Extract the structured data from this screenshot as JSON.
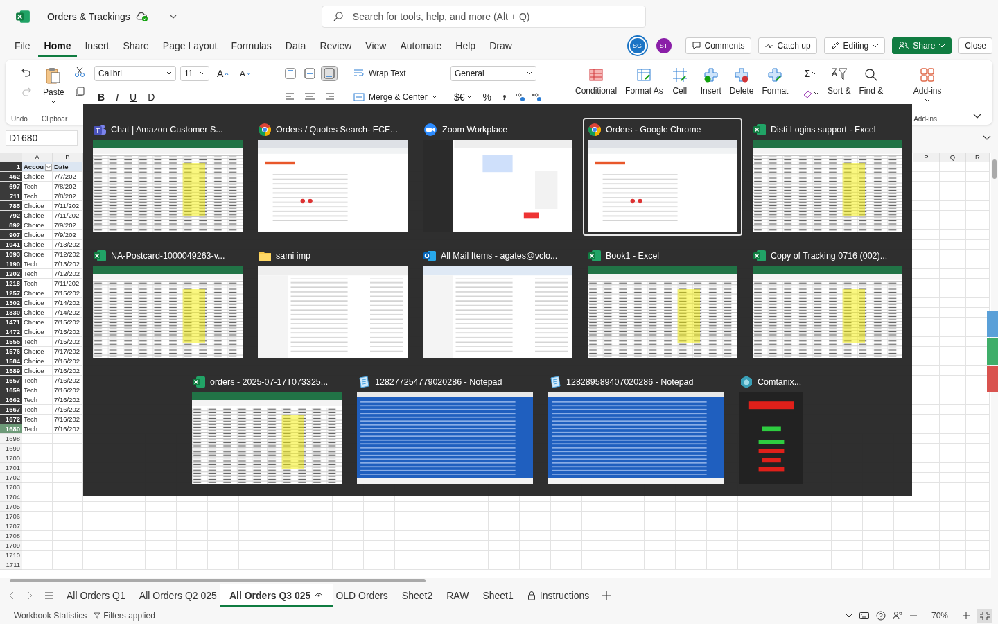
{
  "app": {
    "title": "Orders & Trackings",
    "search_placeholder": "Search for tools, help, and more (Alt + Q)"
  },
  "menu_tabs": [
    {
      "label": "File",
      "selected": false
    },
    {
      "label": "Home",
      "selected": true
    },
    {
      "label": "Insert",
      "selected": false
    },
    {
      "label": "Share",
      "selected": false
    },
    {
      "label": "Page Layout",
      "selected": false
    },
    {
      "label": "Formulas",
      "selected": false
    },
    {
      "label": "Data",
      "selected": false
    },
    {
      "label": "Review",
      "selected": false
    },
    {
      "label": "View",
      "selected": false
    },
    {
      "label": "Automate",
      "selected": false
    },
    {
      "label": "Help",
      "selected": false
    },
    {
      "label": "Draw",
      "selected": false
    }
  ],
  "avatars": [
    {
      "initials": "SG",
      "color": "#1b74c5",
      "active": true
    },
    {
      "initials": "ST",
      "color": "#8a1fa8",
      "active": false
    }
  ],
  "header_buttons": [
    {
      "label": "Comments",
      "kind": "comments"
    },
    {
      "label": "Catch up",
      "kind": "catchup"
    },
    {
      "label": "Editing",
      "kind": "editing"
    },
    {
      "label": "Share",
      "kind": "share"
    },
    {
      "label": "Close",
      "kind": "plain"
    }
  ],
  "ribbon": {
    "history": [
      {
        "kind": "undo",
        "disabled": false
      },
      {
        "kind": "redo",
        "disabled": true
      }
    ],
    "undo_label": "Undo",
    "paste": "Paste",
    "clipboard_label": "Clipboar",
    "font_name": "Calibri",
    "font_size": "11",
    "grow": "A",
    "shrink": "A",
    "styles": [
      "B",
      "I",
      "U",
      "D"
    ],
    "wrap": "Wrap Text",
    "merge": "Merge & Center",
    "number_format": "General",
    "currency": "$€",
    "percent": "%",
    "style_buttons": [
      "Conditional",
      "Format As",
      "Cell"
    ],
    "cell_buttons": [
      "Insert",
      "Delete",
      "Format"
    ],
    "sum": "Σ",
    "sort": "Sort &",
    "find": "Find &",
    "addins": "Add-ins",
    "addins_label": "Add-ins"
  },
  "name_box": "D1680",
  "grid": {
    "left_columns": [
      "A",
      "B"
    ],
    "right_columns": [
      "P",
      "Q",
      "R"
    ],
    "header_row": {
      "number": "1",
      "cells": [
        "Accou",
        "Date"
      ]
    },
    "rows": [
      {
        "number": "462",
        "cells": [
          "Choice",
          "7/7/202"
        ],
        "selected": false
      },
      {
        "number": "697",
        "cells": [
          "Tech",
          "7/8/202"
        ],
        "selected": false
      },
      {
        "number": "711",
        "cells": [
          "Tech",
          "7/8/202"
        ],
        "selected": false
      },
      {
        "number": "785",
        "cells": [
          "Choice",
          "7/11/202"
        ],
        "selected": false
      },
      {
        "number": "792",
        "cells": [
          "Choice",
          "7/11/202"
        ],
        "selected": false
      },
      {
        "number": "892",
        "cells": [
          "Choice",
          "7/9/202"
        ],
        "selected": false
      },
      {
        "number": "907",
        "cells": [
          "Choice",
          "7/9/202"
        ],
        "selected": false
      },
      {
        "number": "1041",
        "cells": [
          "Choice",
          "7/13/202"
        ],
        "selected": false
      },
      {
        "number": "1093",
        "cells": [
          "Choice",
          "7/12/202"
        ],
        "selected": false
      },
      {
        "number": "1190",
        "cells": [
          "Tech",
          "7/13/202"
        ],
        "selected": false
      },
      {
        "number": "1202",
        "cells": [
          "Tech",
          "7/12/202"
        ],
        "selected": false
      },
      {
        "number": "1218",
        "cells": [
          "Tech",
          "7/11/202"
        ],
        "selected": false
      },
      {
        "number": "1257",
        "cells": [
          "Choice",
          "7/15/202"
        ],
        "selected": false
      },
      {
        "number": "1302",
        "cells": [
          "Choice",
          "7/14/202"
        ],
        "selected": false
      },
      {
        "number": "1330",
        "cells": [
          "Choice",
          "7/14/202"
        ],
        "selected": false
      },
      {
        "number": "1471",
        "cells": [
          "Choice",
          "7/15/202"
        ],
        "selected": false
      },
      {
        "number": "1472",
        "cells": [
          "Choice",
          "7/15/202"
        ],
        "selected": false
      },
      {
        "number": "1555",
        "cells": [
          "Tech",
          "7/15/202"
        ],
        "selected": false
      },
      {
        "number": "1576",
        "cells": [
          "Choice",
          "7/17/202"
        ],
        "selected": false
      },
      {
        "number": "1584",
        "cells": [
          "Choice",
          "7/16/202"
        ],
        "selected": false
      },
      {
        "number": "1589",
        "cells": [
          "Choice",
          "7/16/202"
        ],
        "selected": false
      },
      {
        "number": "1657",
        "cells": [
          "Tech",
          "7/16/202"
        ],
        "selected": false
      },
      {
        "number": "1659",
        "cells": [
          "Tech",
          "7/16/202"
        ],
        "selected": false
      },
      {
        "number": "1662",
        "cells": [
          "Tech",
          "7/16/202"
        ],
        "selected": false
      },
      {
        "number": "1667",
        "cells": [
          "Tech",
          "7/16/202"
        ],
        "selected": false
      },
      {
        "number": "1672",
        "cells": [
          "Tech",
          "7/16/202"
        ],
        "selected": false
      },
      {
        "number": "1680",
        "cells": [
          "Tech",
          "7/16/202"
        ],
        "selected": true
      }
    ],
    "empty_rows": [
      "1698",
      "1699",
      "1700",
      "1701",
      "1702",
      "1703",
      "1704",
      "1705",
      "1706",
      "1707",
      "1708",
      "1709",
      "1710",
      "1711"
    ]
  },
  "task_switcher": {
    "rows": [
      {
        "windows": [
          {
            "title": "Chat | Amazon Customer S...",
            "kind": "teams",
            "selected": false
          },
          {
            "title": "Orders / Quotes Search- ECE...",
            "kind": "chrome",
            "selected": false
          },
          {
            "title": "Zoom Workplace",
            "kind": "zoom",
            "selected": false
          },
          {
            "title": "Orders - Google Chrome",
            "kind": "chrome",
            "selected": true
          },
          {
            "title": "Disti Logins support - Excel",
            "kind": "excel",
            "selected": false
          }
        ]
      },
      {
        "windows": [
          {
            "title": "NA-Postcard-1000049263-v...",
            "kind": "excel",
            "selected": false
          },
          {
            "title": "sami imp",
            "kind": "folder",
            "selected": false
          },
          {
            "title": "All Mail Items - agates@vclo...",
            "kind": "outlook",
            "selected": false
          },
          {
            "title": "Book1 - Excel",
            "kind": "excel",
            "selected": false
          },
          {
            "title": "Copy of Tracking 0716 (002)...",
            "kind": "excel",
            "selected": false
          }
        ]
      },
      {
        "windows": [
          {
            "title": "orders - 2025-07-17T073325...",
            "kind": "excel",
            "selected": false
          },
          {
            "title": "128277254779020286 - Notepad",
            "kind": "notepad",
            "selected": false
          },
          {
            "title": "128289589407020286 - Notepad",
            "kind": "notepad",
            "selected": false
          },
          {
            "title": "Comtanix...",
            "kind": "comtanix",
            "selected": false
          }
        ]
      }
    ]
  },
  "sheet_tabs": [
    {
      "label": "All Orders Q1",
      "kind": "plain",
      "selected": false
    },
    {
      "label": "All Orders Q2 025",
      "kind": "plain",
      "selected": false
    },
    {
      "label": "All Orders Q3 025",
      "kind": "watched",
      "selected": true
    },
    {
      "label": "OLD Orders",
      "kind": "plain",
      "selected": false
    },
    {
      "label": "Sheet2",
      "kind": "plain",
      "selected": false
    },
    {
      "label": "RAW",
      "kind": "plain",
      "selected": false
    },
    {
      "label": "Sheet1",
      "kind": "plain",
      "selected": false
    },
    {
      "label": "Instructions",
      "kind": "locked",
      "selected": false
    }
  ],
  "status_bar": {
    "statistics": "Workbook Statistics",
    "filters": "Filters applied",
    "zoom": "70%"
  }
}
